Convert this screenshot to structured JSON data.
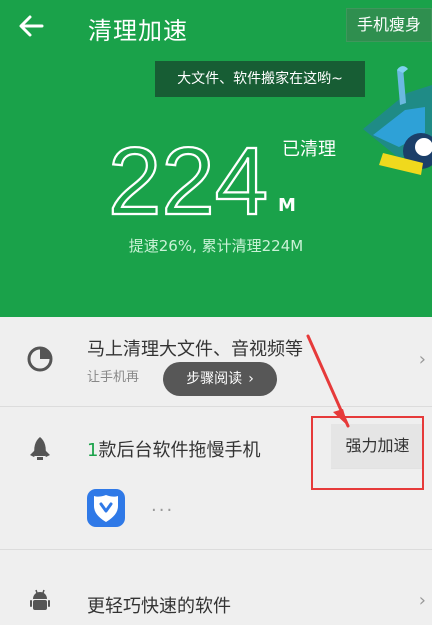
{
  "header": {
    "title": "清理加速",
    "slim_label": "手机瘦身",
    "tooltip": "大文件、软件搬家在这哟~"
  },
  "summary": {
    "cleaned_value": "224",
    "cleaned_label": "已清理",
    "unit": "M",
    "detail": "提速26%, 累计清理224M"
  },
  "rows": {
    "large_files": {
      "title": "马上清理大文件、音视频等",
      "subtitle": "让手机再"
    },
    "background_apps": {
      "count": "1",
      "title": "款后台软件拖慢手机",
      "boost_label": "强力加速"
    },
    "light_apps": {
      "title": "更轻巧快速的软件"
    }
  },
  "overlay": {
    "step_read": "步骤阅读"
  },
  "colors": {
    "primary_green": "#1aa24a",
    "tooltip_green": "#175d34",
    "highlight_red": "#e63a3a"
  },
  "icons": {
    "back": "back-arrow-icon",
    "clock": "pie-clock-icon",
    "rocket": "rocket-icon",
    "android": "android-icon",
    "shield_app": "shield-app-icon",
    "chevron": "chevron-right-icon"
  }
}
